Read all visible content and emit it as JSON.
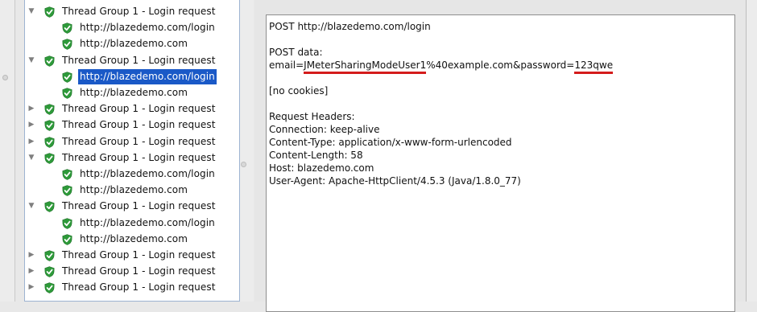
{
  "tree": {
    "rows": [
      {
        "label": "Thread Group 1 - Login request",
        "level": 0,
        "toggle": "expanded"
      },
      {
        "label": "http://blazedemo.com/login",
        "level": 1,
        "toggle": "none"
      },
      {
        "label": "http://blazedemo.com",
        "level": 1,
        "toggle": "none"
      },
      {
        "label": "Thread Group 1 - Login request",
        "level": 0,
        "toggle": "expanded"
      },
      {
        "label": "http://blazedemo.com/login",
        "level": 1,
        "toggle": "none",
        "selected": true
      },
      {
        "label": "http://blazedemo.com",
        "level": 1,
        "toggle": "none"
      },
      {
        "label": "Thread Group 1 - Login request",
        "level": 0,
        "toggle": "collapsed"
      },
      {
        "label": "Thread Group 1 - Login request",
        "level": 0,
        "toggle": "collapsed"
      },
      {
        "label": "Thread Group 1 - Login request",
        "level": 0,
        "toggle": "collapsed"
      },
      {
        "label": "Thread Group 1 - Login request",
        "level": 0,
        "toggle": "expanded"
      },
      {
        "label": "http://blazedemo.com/login",
        "level": 1,
        "toggle": "none"
      },
      {
        "label": "http://blazedemo.com",
        "level": 1,
        "toggle": "none"
      },
      {
        "label": "Thread Group 1 - Login request",
        "level": 0,
        "toggle": "expanded"
      },
      {
        "label": "http://blazedemo.com/login",
        "level": 1,
        "toggle": "none"
      },
      {
        "label": "http://blazedemo.com",
        "level": 1,
        "toggle": "none"
      },
      {
        "label": "Thread Group 1 - Login request",
        "level": 0,
        "toggle": "collapsed"
      },
      {
        "label": "Thread Group 1 - Login request",
        "level": 0,
        "toggle": "collapsed"
      },
      {
        "label": "Thread Group 1 - Login request",
        "level": 0,
        "toggle": "collapsed"
      }
    ],
    "status_icon": "green-shield-check-icon"
  },
  "request": {
    "request_line": "POST http://blazedemo.com/login",
    "post_data_label": "POST data:",
    "post_email_prefix": "email=",
    "post_email_user": "JMeterSharingModeUser1",
    "post_email_rest": "%40example.com&password=",
    "post_password": "123qwe",
    "cookies": "[no cookies]",
    "headers_label": "Request Headers:",
    "headers": [
      "Connection: keep-alive",
      "Content-Type: application/x-www-form-urlencoded",
      "Content-Length: 58",
      "Host: blazedemo.com",
      "User-Agent: Apache-HttpClient/4.5.3 (Java/1.8.0_77)"
    ]
  },
  "colors": {
    "selection": "#1a59c7",
    "highlight_underline": "#d41c1c",
    "status_green": "#2e9a3a"
  }
}
